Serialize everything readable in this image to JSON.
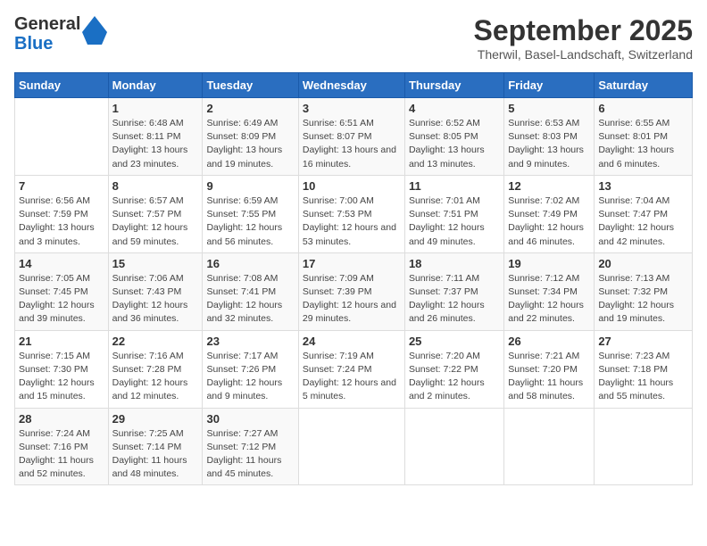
{
  "logo": {
    "general": "General",
    "blue": "Blue"
  },
  "title": "September 2025",
  "location": "Therwil, Basel-Landschaft, Switzerland",
  "weekdays": [
    "Sunday",
    "Monday",
    "Tuesday",
    "Wednesday",
    "Thursday",
    "Friday",
    "Saturday"
  ],
  "weeks": [
    [
      null,
      {
        "day": "1",
        "sunrise": "Sunrise: 6:48 AM",
        "sunset": "Sunset: 8:11 PM",
        "daylight": "Daylight: 13 hours and 23 minutes."
      },
      {
        "day": "2",
        "sunrise": "Sunrise: 6:49 AM",
        "sunset": "Sunset: 8:09 PM",
        "daylight": "Daylight: 13 hours and 19 minutes."
      },
      {
        "day": "3",
        "sunrise": "Sunrise: 6:51 AM",
        "sunset": "Sunset: 8:07 PM",
        "daylight": "Daylight: 13 hours and 16 minutes."
      },
      {
        "day": "4",
        "sunrise": "Sunrise: 6:52 AM",
        "sunset": "Sunset: 8:05 PM",
        "daylight": "Daylight: 13 hours and 13 minutes."
      },
      {
        "day": "5",
        "sunrise": "Sunrise: 6:53 AM",
        "sunset": "Sunset: 8:03 PM",
        "daylight": "Daylight: 13 hours and 9 minutes."
      },
      {
        "day": "6",
        "sunrise": "Sunrise: 6:55 AM",
        "sunset": "Sunset: 8:01 PM",
        "daylight": "Daylight: 13 hours and 6 minutes."
      }
    ],
    [
      {
        "day": "7",
        "sunrise": "Sunrise: 6:56 AM",
        "sunset": "Sunset: 7:59 PM",
        "daylight": "Daylight: 13 hours and 3 minutes."
      },
      {
        "day": "8",
        "sunrise": "Sunrise: 6:57 AM",
        "sunset": "Sunset: 7:57 PM",
        "daylight": "Daylight: 12 hours and 59 minutes."
      },
      {
        "day": "9",
        "sunrise": "Sunrise: 6:59 AM",
        "sunset": "Sunset: 7:55 PM",
        "daylight": "Daylight: 12 hours and 56 minutes."
      },
      {
        "day": "10",
        "sunrise": "Sunrise: 7:00 AM",
        "sunset": "Sunset: 7:53 PM",
        "daylight": "Daylight: 12 hours and 53 minutes."
      },
      {
        "day": "11",
        "sunrise": "Sunrise: 7:01 AM",
        "sunset": "Sunset: 7:51 PM",
        "daylight": "Daylight: 12 hours and 49 minutes."
      },
      {
        "day": "12",
        "sunrise": "Sunrise: 7:02 AM",
        "sunset": "Sunset: 7:49 PM",
        "daylight": "Daylight: 12 hours and 46 minutes."
      },
      {
        "day": "13",
        "sunrise": "Sunrise: 7:04 AM",
        "sunset": "Sunset: 7:47 PM",
        "daylight": "Daylight: 12 hours and 42 minutes."
      }
    ],
    [
      {
        "day": "14",
        "sunrise": "Sunrise: 7:05 AM",
        "sunset": "Sunset: 7:45 PM",
        "daylight": "Daylight: 12 hours and 39 minutes."
      },
      {
        "day": "15",
        "sunrise": "Sunrise: 7:06 AM",
        "sunset": "Sunset: 7:43 PM",
        "daylight": "Daylight: 12 hours and 36 minutes."
      },
      {
        "day": "16",
        "sunrise": "Sunrise: 7:08 AM",
        "sunset": "Sunset: 7:41 PM",
        "daylight": "Daylight: 12 hours and 32 minutes."
      },
      {
        "day": "17",
        "sunrise": "Sunrise: 7:09 AM",
        "sunset": "Sunset: 7:39 PM",
        "daylight": "Daylight: 12 hours and 29 minutes."
      },
      {
        "day": "18",
        "sunrise": "Sunrise: 7:11 AM",
        "sunset": "Sunset: 7:37 PM",
        "daylight": "Daylight: 12 hours and 26 minutes."
      },
      {
        "day": "19",
        "sunrise": "Sunrise: 7:12 AM",
        "sunset": "Sunset: 7:34 PM",
        "daylight": "Daylight: 12 hours and 22 minutes."
      },
      {
        "day": "20",
        "sunrise": "Sunrise: 7:13 AM",
        "sunset": "Sunset: 7:32 PM",
        "daylight": "Daylight: 12 hours and 19 minutes."
      }
    ],
    [
      {
        "day": "21",
        "sunrise": "Sunrise: 7:15 AM",
        "sunset": "Sunset: 7:30 PM",
        "daylight": "Daylight: 12 hours and 15 minutes."
      },
      {
        "day": "22",
        "sunrise": "Sunrise: 7:16 AM",
        "sunset": "Sunset: 7:28 PM",
        "daylight": "Daylight: 12 hours and 12 minutes."
      },
      {
        "day": "23",
        "sunrise": "Sunrise: 7:17 AM",
        "sunset": "Sunset: 7:26 PM",
        "daylight": "Daylight: 12 hours and 9 minutes."
      },
      {
        "day": "24",
        "sunrise": "Sunrise: 7:19 AM",
        "sunset": "Sunset: 7:24 PM",
        "daylight": "Daylight: 12 hours and 5 minutes."
      },
      {
        "day": "25",
        "sunrise": "Sunrise: 7:20 AM",
        "sunset": "Sunset: 7:22 PM",
        "daylight": "Daylight: 12 hours and 2 minutes."
      },
      {
        "day": "26",
        "sunrise": "Sunrise: 7:21 AM",
        "sunset": "Sunset: 7:20 PM",
        "daylight": "Daylight: 11 hours and 58 minutes."
      },
      {
        "day": "27",
        "sunrise": "Sunrise: 7:23 AM",
        "sunset": "Sunset: 7:18 PM",
        "daylight": "Daylight: 11 hours and 55 minutes."
      }
    ],
    [
      {
        "day": "28",
        "sunrise": "Sunrise: 7:24 AM",
        "sunset": "Sunset: 7:16 PM",
        "daylight": "Daylight: 11 hours and 52 minutes."
      },
      {
        "day": "29",
        "sunrise": "Sunrise: 7:25 AM",
        "sunset": "Sunset: 7:14 PM",
        "daylight": "Daylight: 11 hours and 48 minutes."
      },
      {
        "day": "30",
        "sunrise": "Sunrise: 7:27 AM",
        "sunset": "Sunset: 7:12 PM",
        "daylight": "Daylight: 11 hours and 45 minutes."
      },
      null,
      null,
      null,
      null
    ]
  ]
}
